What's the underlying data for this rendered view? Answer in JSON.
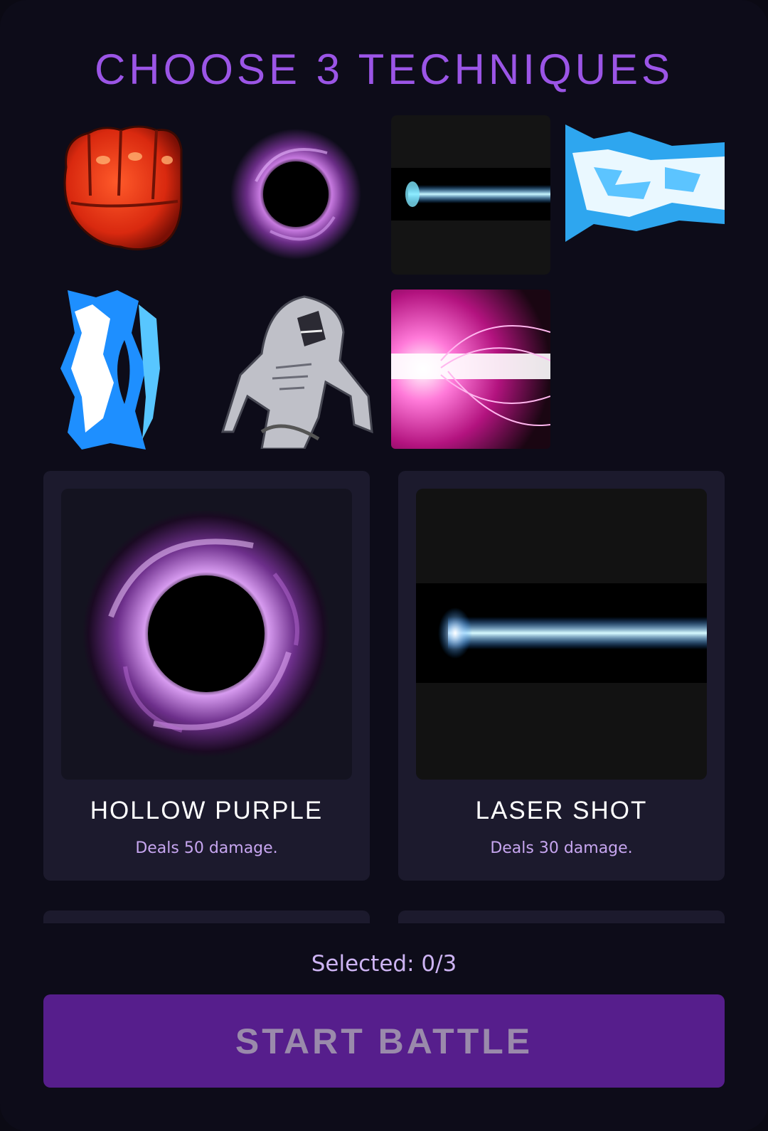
{
  "header": {
    "title": "CHOOSE 3 TECHNIQUES"
  },
  "techniques_grid": [
    {
      "icon": "red-fist-icon"
    },
    {
      "icon": "purple-vortex-icon"
    },
    {
      "icon": "cyan-laser-beam-icon"
    },
    {
      "icon": "blue-energy-blast-icon"
    },
    {
      "icon": "blue-energy-shield-icon"
    },
    {
      "icon": "white-demon-creature-icon"
    },
    {
      "icon": "pink-lightning-blast-icon"
    }
  ],
  "cards": [
    {
      "name": "HOLLOW PURPLE",
      "description": "Deals 50 damage.",
      "icon": "purple-vortex-icon"
    },
    {
      "name": "LASER SHOT",
      "description": "Deals 30 damage.",
      "icon": "cyan-laser-beam-icon"
    }
  ],
  "footer": {
    "selected_text": "Selected: 0/3",
    "start_label": "START BATTLE"
  },
  "colors": {
    "accent": "#9b55e6",
    "button": "#561e8c",
    "card": "#1c1a2d"
  }
}
